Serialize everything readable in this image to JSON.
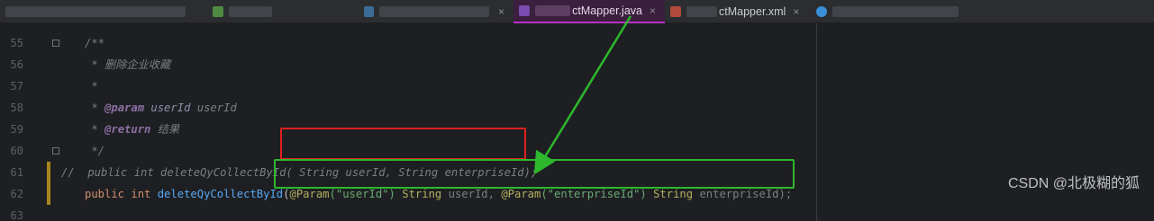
{
  "tabs": [
    {
      "label": "",
      "icon": "file-icon",
      "close": ""
    },
    {
      "label": "",
      "icon": "kotlin-file-icon",
      "close": ""
    },
    {
      "label": "",
      "icon": "java-file-icon",
      "close": "×"
    },
    {
      "label": "ctMapper.java",
      "icon": "java-interface-icon",
      "close": "×"
    },
    {
      "label": "ctMapper.xml",
      "icon": "xml-file-icon",
      "close": "×"
    },
    {
      "label": "",
      "icon": "class-icon",
      "close": ""
    }
  ],
  "lines": [
    {
      "num": "55"
    },
    {
      "num": "56"
    },
    {
      "num": "57"
    },
    {
      "num": "58"
    },
    {
      "num": "59"
    },
    {
      "num": "60"
    },
    {
      "num": "61"
    },
    {
      "num": "62"
    },
    {
      "num": "63"
    }
  ],
  "code": {
    "l55": "/**",
    "l56": " * 删除企业收藏",
    "l57": " *",
    "l58_star": " * ",
    "l58_tag": "@param",
    "l58_name": " userId",
    "l58_desc": " userId",
    "l59_star": " * ",
    "l59_tag": "@return",
    "l59_desc": " 结果",
    "l60": " */",
    "l61": "//  public int deleteQyCollectById( String userId, String enterpriseId);",
    "l62_kw1": "public",
    "l62_kw2": " int ",
    "l62_fn": "deleteQyCollectById",
    "l62_p1": "(",
    "l62_ann1": "@Param",
    "l62_s1": "(\"userId\")",
    "l62_t1": " String",
    "l62_v1": " userId, ",
    "l62_ann2": "@Param",
    "l62_s2": "(\"enterpriseId\")",
    "l62_t2": " String",
    "l62_v2": " enterpriseId);"
  },
  "watermark": "CSDN @北极糊的狐",
  "colors": {
    "background": "#1e1f22",
    "active_tab": "#b733c8",
    "annotation_red": "#e02020",
    "annotation_green": "#2db82d"
  }
}
